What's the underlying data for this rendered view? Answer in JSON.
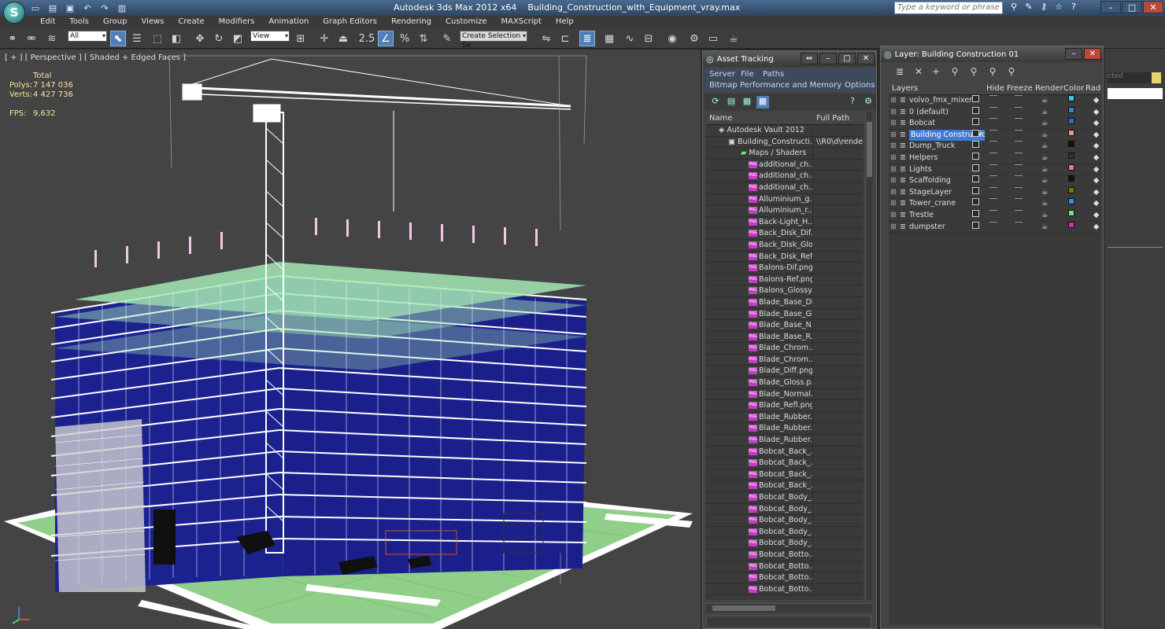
{
  "titlebar": {
    "app_name": "Autodesk 3ds Max  2012 x64",
    "file_name": "Building_Construction_with_Equipment_vray.max",
    "search_placeholder": "Type a keyword or phrase"
  },
  "menu": [
    "Edit",
    "Tools",
    "Group",
    "Views",
    "Create",
    "Modifiers",
    "Animation",
    "Graph Editors",
    "Rendering",
    "Customize",
    "MAXScript",
    "Help"
  ],
  "toolbar": {
    "filter_value": "All",
    "ref_coord_value": "View",
    "snap_value": "2.5",
    "selection_set_placeholder": "Create Selection Se"
  },
  "viewport": {
    "label": "[ + ] [ Perspective ] [ Shaded + Edged Faces ]",
    "stats_header": "Total",
    "polys_label": "Polys:",
    "polys_value": "7 147 036",
    "verts_label": "Verts:",
    "verts_value": "4 427 736",
    "fps_label": "FPS:",
    "fps_value": "9,632",
    "colors": {
      "ground": "#7fbf7f",
      "slab": "#9fe3b0",
      "glass": "#1a1f8c",
      "wire": "#ffffff",
      "bg": "#444444"
    }
  },
  "asset_tracking": {
    "title": "Asset Tracking",
    "menu": {
      "server": "Server",
      "file": "File",
      "paths": "Paths",
      "bitmap": "Bitmap Performance and Memory",
      "options": "Options"
    },
    "col_name": "Name",
    "col_path": "Full Path",
    "root": "Autodesk Vault 2012",
    "file_row": {
      "name": "Building_Constructi...",
      "path": "\\\\R0\\d\\rende"
    },
    "maps_group": "Maps / Shaders",
    "files": [
      "additional_ch...",
      "additional_ch...",
      "additional_ch...",
      "Alluminium_g...",
      "Alluminium_r...",
      "Back-Light_H...",
      "Back_Disk_Dif...",
      "Back_Disk_Glo...",
      "Back_Disk_Ref...",
      "Balons-Dif.png",
      "Balons-Ref.png",
      "Balons_Glossy...",
      "Blade_Base_Di...",
      "Blade_Base_Gl...",
      "Blade_Base_N...",
      "Blade_Base_R...",
      "Blade_Chrom...",
      "Blade_Chrom...",
      "Blade_Diff.png",
      "Blade_Gloss.p...",
      "Blade_Normal...",
      "Blade_Refl.png",
      "Blade_Rubber...",
      "Blade_Rubber...",
      "Blade_Rubber...",
      "Bobcat_Back_...",
      "Bobcat_Back_...",
      "Bobcat_Back_...",
      "Bobcat_Back_...",
      "Bobcat_Body_...",
      "Bobcat_Body_...",
      "Bobcat_Body_...",
      "Bobcat_Body_...",
      "Bobcat_Body_...",
      "Bobcat_Botto...",
      "Bobcat_Botto...",
      "Bobcat_Botto...",
      "Bobcat_Botto..."
    ]
  },
  "layers": {
    "title": "Layer: Building Construction 01",
    "cols": {
      "layers": "Layers",
      "hide": "Hide",
      "freeze": "Freeze",
      "render": "Render",
      "color": "Color",
      "radio": "Radi"
    },
    "items": [
      {
        "name": "volvo_fmx_mixer",
        "color": "#3fc6d8"
      },
      {
        "name": "0 (default)",
        "color": "#3c7fd8"
      },
      {
        "name": "Bobcat",
        "color": "#2f6fd0"
      },
      {
        "name": "Building Constructio",
        "color": "#e89a7a",
        "selected": true
      },
      {
        "name": "Dump_Truck",
        "color": "#111111"
      },
      {
        "name": "Helpers",
        "color": "#333333"
      },
      {
        "name": "Lights",
        "color": "#e07aa0"
      },
      {
        "name": "Scaffolding",
        "color": "#111111"
      },
      {
        "name": "StageLayer",
        "color": "#8a6a10"
      },
      {
        "name": "Tower_crane",
        "color": "#3f8fd8"
      },
      {
        "name": "Trestle",
        "color": "#7ae07a"
      },
      {
        "name": "dumpster",
        "color": "#d02fa8"
      }
    ]
  },
  "cmdpanel": {
    "field_text": "cted"
  }
}
